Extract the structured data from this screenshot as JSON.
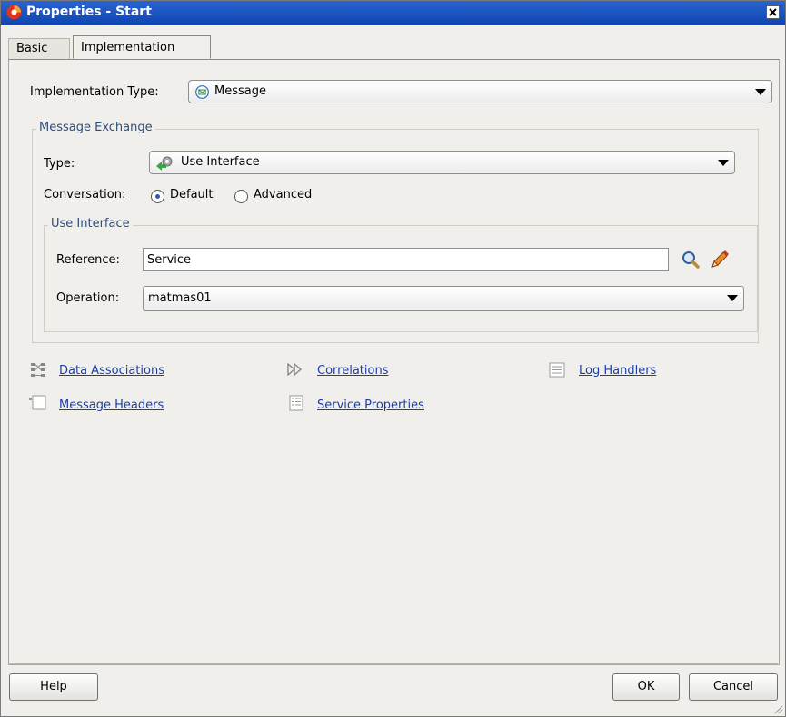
{
  "window": {
    "title": "Properties - Start"
  },
  "tabs": [
    {
      "label": "Basic",
      "active": false
    },
    {
      "label": "Implementation",
      "active": true
    }
  ],
  "implementation_type": {
    "label": "Implementation Type:",
    "value": "Message",
    "icon": "message-envelope-icon"
  },
  "message_exchange": {
    "legend": "Message Exchange",
    "type_label": "Type:",
    "type_value": "Use Interface",
    "type_icon": "gear-interface-icon",
    "conversation_label": "Conversation:",
    "conversation_options": [
      {
        "label": "Default",
        "selected": true
      },
      {
        "label": "Advanced",
        "selected": false
      }
    ],
    "use_interface": {
      "legend": "Use Interface",
      "reference_label": "Reference:",
      "reference_value": "Service",
      "operation_label": "Operation:",
      "operation_value": "matmas01"
    }
  },
  "links": {
    "data_associations": "Data Associations",
    "correlations": "Correlations",
    "log_handlers": "Log Handlers",
    "message_headers": "Message Headers",
    "service_properties": "Service Properties"
  },
  "buttons": {
    "help": "Help",
    "ok": "OK",
    "cancel": "Cancel"
  },
  "colors": {
    "titlebar": "#0f45b1",
    "link": "#1a3ea8",
    "legend": "#2d4d7b"
  }
}
